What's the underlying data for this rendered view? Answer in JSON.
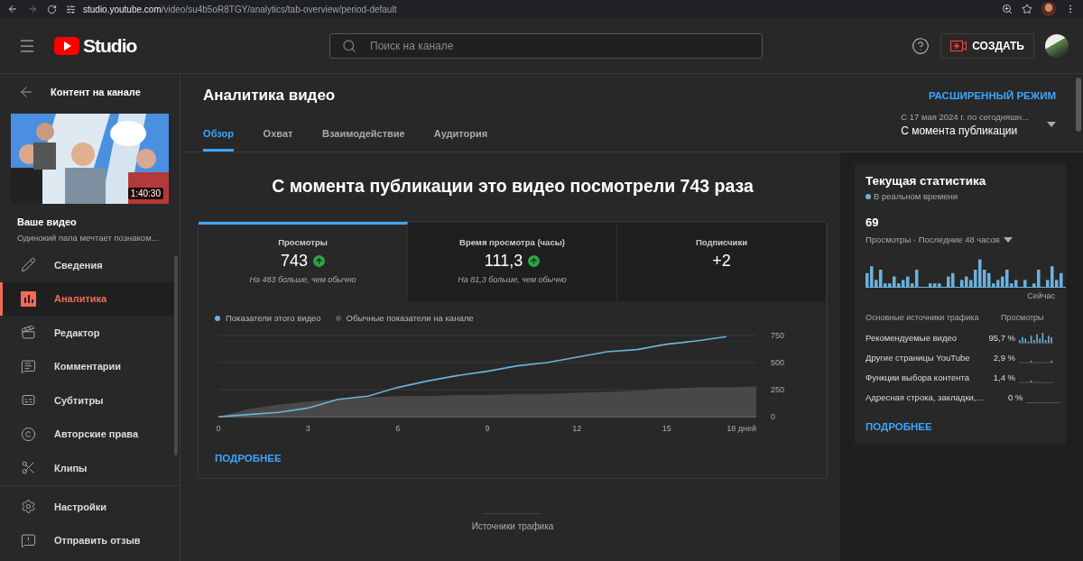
{
  "browser": {
    "url_host": "studio.youtube.com",
    "url_path": "/video/su4b5oR8TGY/analytics/tab-overview/period-default"
  },
  "header": {
    "logo_text": "Studio",
    "search": {
      "placeholder": "Поиск на канале"
    },
    "create_label": "СОЗДАТЬ"
  },
  "sidebar": {
    "back_title": "Контент на канале",
    "video": {
      "duration": "1:40:30",
      "label": "Ваше видео",
      "title": "Одинокий папа мечтает познаком..."
    },
    "items": [
      {
        "label": "Сведения",
        "selected": false
      },
      {
        "label": "Аналитика",
        "selected": true
      },
      {
        "label": "Редактор",
        "selected": false
      },
      {
        "label": "Комментарии",
        "selected": false
      },
      {
        "label": "Субтитры",
        "selected": false
      },
      {
        "label": "Авторские права",
        "selected": false
      },
      {
        "label": "Клипы",
        "selected": false
      }
    ],
    "footer_items": [
      {
        "label": "Настройки"
      },
      {
        "label": "Отправить отзыв"
      }
    ]
  },
  "page": {
    "title": "Аналитика видео",
    "advanced_link": "РАСШИРЕННЫЙ РЕЖИМ",
    "tabs": [
      {
        "label": "Обзор",
        "selected": true
      },
      {
        "label": "Охват",
        "selected": false
      },
      {
        "label": "Взаимодействие",
        "selected": false
      },
      {
        "label": "Аудитория",
        "selected": false
      }
    ],
    "period": {
      "range": "С 17 мая 2024 г. по сегодняшн...",
      "label": "С момента публикации"
    }
  },
  "overview": {
    "headline": "С момента публикации это видео посмотрели 743 раза",
    "metrics": [
      {
        "label": "Просмотры",
        "value": "743",
        "trending_up": true,
        "note": "На 483 больше, чем обычно",
        "selected": true
      },
      {
        "label": "Время просмотра (часы)",
        "value": "111,3",
        "trending_up": true,
        "note": "На 81,3 больше, чем обычно",
        "selected": false
      },
      {
        "label": "Подписчики",
        "value": "+2",
        "trending_up": false,
        "selected": false
      }
    ],
    "chart_data": {
      "type": "line",
      "x": [
        0,
        1,
        2,
        3,
        4,
        5,
        6,
        7,
        8,
        9,
        10,
        11,
        12,
        13,
        14,
        15,
        16,
        17,
        18
      ],
      "series": [
        {
          "name": "Показатели этого видео",
          "color": "#6bb3dd",
          "type": "line",
          "values": [
            0,
            20,
            40,
            80,
            160,
            190,
            270,
            330,
            380,
            420,
            470,
            500,
            550,
            600,
            620,
            670,
            700,
            740,
            null
          ]
        },
        {
          "name": "Обычные показатели на канале",
          "color": "#555555",
          "type": "area",
          "values": [
            0,
            70,
            110,
            140,
            160,
            180,
            190,
            190,
            200,
            200,
            210,
            210,
            220,
            230,
            240,
            260,
            270,
            270,
            280
          ]
        }
      ],
      "xlim": [
        0,
        18
      ],
      "ylim": [
        0,
        750
      ],
      "xticks": [
        0,
        3,
        6,
        9,
        12,
        15,
        {
          "value": 18,
          "label": "18 дней"
        }
      ],
      "yticks": [
        0,
        250,
        500,
        750
      ]
    },
    "more_link": "ПОДРОБНЕЕ",
    "next_section": "Источники трафика"
  },
  "realtime": {
    "title": "Текущая статистика",
    "live_label": "В реальном времени",
    "count": "69",
    "metric_label": "Просмотры · Последние 48 часов",
    "now_label": "Сейчас",
    "sources_header": "Основные источники трафика",
    "views_header": "Просмотры",
    "sources": [
      {
        "name": "Рекомендуемые видео",
        "share": "95,7 %"
      },
      {
        "name": "Другие страницы YouTube",
        "share": "2,9 %"
      },
      {
        "name": "Функции выбора контента",
        "share": "1,4 %"
      },
      {
        "name": "Адресная строка, закладки,...",
        "share": "0 %"
      }
    ],
    "more_link": "ПОДРОБНЕЕ"
  }
}
